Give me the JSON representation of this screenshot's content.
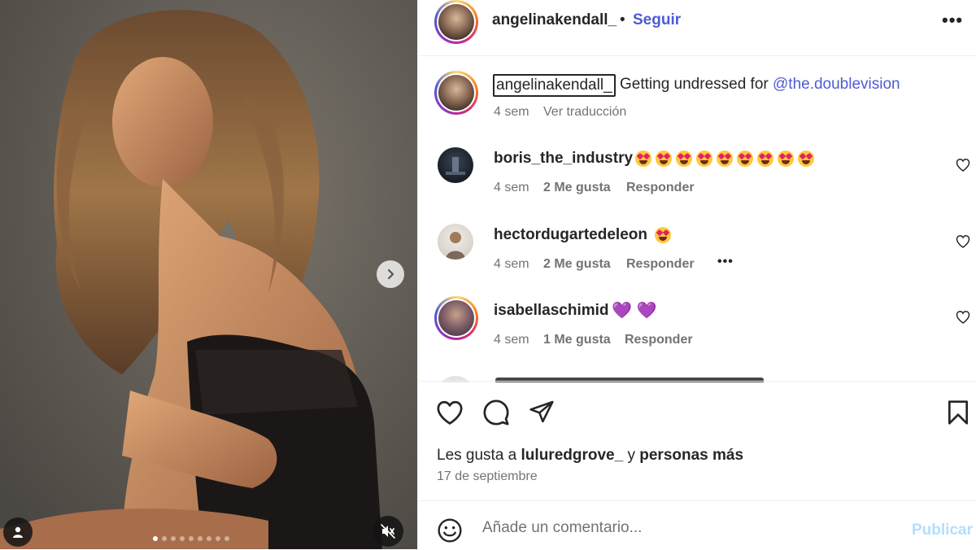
{
  "post": {
    "author": "angelinakendall_",
    "follow_label": "Seguir",
    "separator": "•",
    "more_label": "•••"
  },
  "caption": {
    "username": "angelinakendall_",
    "text": "Getting undressed for ",
    "mention": "@the.doublevision",
    "time": "4 sem",
    "translate_label": "Ver traducción"
  },
  "comments": [
    {
      "username": "boris_the_industry",
      "emoji_count": 9,
      "emoji": "smiling-face-heart-eyes",
      "time": "4 sem",
      "likes": "2 Me gusta",
      "reply": "Responder"
    },
    {
      "username": "hectordugartedeleon",
      "emoji_count": 1,
      "emoji": "smiling-face-heart-eyes",
      "time": "4 sem",
      "likes": "2 Me gusta",
      "reply": "Responder",
      "more": "•••"
    },
    {
      "username": "isabellaschimid",
      "text": "💜 💜",
      "time": "4 sem",
      "likes": "1 Me gusta",
      "reply": "Responder"
    }
  ],
  "likes": {
    "prefix": "Les gusta a ",
    "user": "luluredgrove_",
    "middle": " y ",
    "suffix": "personas más"
  },
  "date": "17 de septiembre",
  "comment_box": {
    "placeholder": "Añade un comentario...",
    "publish_label": "Publicar"
  },
  "carousel": {
    "total": 9,
    "active_index": 0
  },
  "icons": {
    "like": "heart-icon",
    "comment": "comment-icon",
    "share": "paper-plane-icon",
    "save": "bookmark-icon",
    "emoji": "emoji-smiley-icon",
    "next": "chevron-right-icon",
    "tags": "user-tag-icon",
    "mute": "speaker-muted-icon"
  },
  "colors": {
    "link": "#4f5bd5",
    "publish_disabled": "#b2dffc",
    "muted_text": "#737373",
    "purple_heart": "#9b3bd6"
  }
}
